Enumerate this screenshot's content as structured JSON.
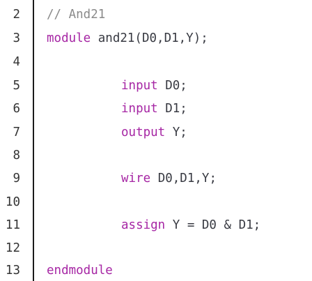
{
  "editor": {
    "colors": {
      "keyword": "#a626a4",
      "comment": "#8a8a8a",
      "text": "#383a42",
      "line_number": "#333333",
      "gutter_border": "#1a1a1a"
    },
    "lines": [
      {
        "num": "2",
        "comment": "// And21"
      },
      {
        "num": "3",
        "kw": "module",
        "rest": " and21(D0,D1,Y);"
      },
      {
        "num": "4"
      },
      {
        "num": "5",
        "kw": "input",
        "rest": " D0;"
      },
      {
        "num": "6",
        "kw": "input",
        "rest": " D1;"
      },
      {
        "num": "7",
        "kw": "output",
        "rest": " Y;"
      },
      {
        "num": "8"
      },
      {
        "num": "9",
        "kw": "wire",
        "rest": " D0,D1,Y;"
      },
      {
        "num": "10"
      },
      {
        "num": "11",
        "kw": "assign",
        "rest": " Y = D0 & D1;"
      },
      {
        "num": "12"
      },
      {
        "num": "13",
        "kw": "endmodule"
      }
    ]
  }
}
